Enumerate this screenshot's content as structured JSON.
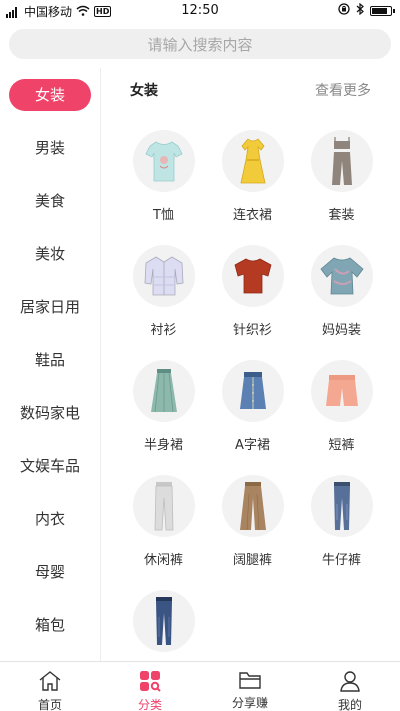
{
  "status_bar": {
    "carrier": "中国移动",
    "time": "12:50",
    "volte": "HD"
  },
  "search": {
    "placeholder": "请输入搜索内容"
  },
  "sidebar": {
    "items": [
      {
        "label": "女装",
        "active": true
      },
      {
        "label": "男装"
      },
      {
        "label": "美食"
      },
      {
        "label": "美妆"
      },
      {
        "label": "居家日用"
      },
      {
        "label": "鞋品"
      },
      {
        "label": "数码家电"
      },
      {
        "label": "文娱车品"
      },
      {
        "label": "内衣"
      },
      {
        "label": "母婴"
      },
      {
        "label": "箱包"
      }
    ]
  },
  "main": {
    "title": "女装",
    "more": "查看更多",
    "items": [
      {
        "label": "T恤",
        "icon": "tshirt-icon"
      },
      {
        "label": "连衣裙",
        "icon": "dress-icon"
      },
      {
        "label": "套装",
        "icon": "suit-set-icon"
      },
      {
        "label": "衬衫",
        "icon": "shirt-icon"
      },
      {
        "label": "针织衫",
        "icon": "knit-sweater-icon"
      },
      {
        "label": "妈妈装",
        "icon": "mom-top-icon"
      },
      {
        "label": "半身裙",
        "icon": "skirt-icon"
      },
      {
        "label": "A字裙",
        "icon": "a-line-skirt-icon"
      },
      {
        "label": "短裤",
        "icon": "shorts-icon"
      },
      {
        "label": "休闲裤",
        "icon": "casual-pants-icon"
      },
      {
        "label": "阔腿裤",
        "icon": "wide-leg-pants-icon"
      },
      {
        "label": "牛仔裤",
        "icon": "jeans-icon"
      },
      {
        "label": "",
        "icon": "jeans-dark-icon"
      }
    ]
  },
  "tab_bar": {
    "tabs": [
      {
        "label": "首页",
        "icon": "home-icon"
      },
      {
        "label": "分类",
        "icon": "category-icon",
        "active": true
      },
      {
        "label": "分享赚",
        "icon": "folder-icon"
      },
      {
        "label": "我的",
        "icon": "user-icon"
      }
    ]
  },
  "colors": {
    "accent": "#f0436a",
    "sidebar_text": "#333333",
    "muted": "#888888"
  }
}
